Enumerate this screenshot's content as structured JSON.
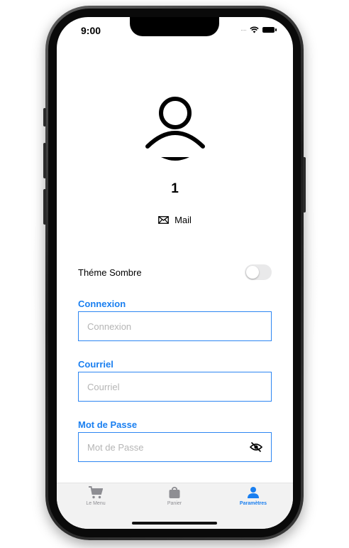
{
  "status_bar": {
    "time": "9:00"
  },
  "profile": {
    "number": "1",
    "mail_label": "Mail"
  },
  "settings": {
    "theme_label": "Théme Sombre",
    "theme_enabled": false
  },
  "form": {
    "login_label": "Connexion",
    "login_placeholder": "Connexion",
    "email_label": "Courriel",
    "email_placeholder": "Courriel",
    "password_label": "Mot de Passe",
    "password_placeholder": "Mot de Passe"
  },
  "tabbar": {
    "tabs": [
      {
        "label": "Le Menu",
        "icon": "cart-icon"
      },
      {
        "label": "Panier",
        "icon": "bag-icon"
      },
      {
        "label": "Paramètres",
        "icon": "person-icon"
      }
    ],
    "active_index": 2
  },
  "colors": {
    "accent": "#1a7ff0"
  }
}
